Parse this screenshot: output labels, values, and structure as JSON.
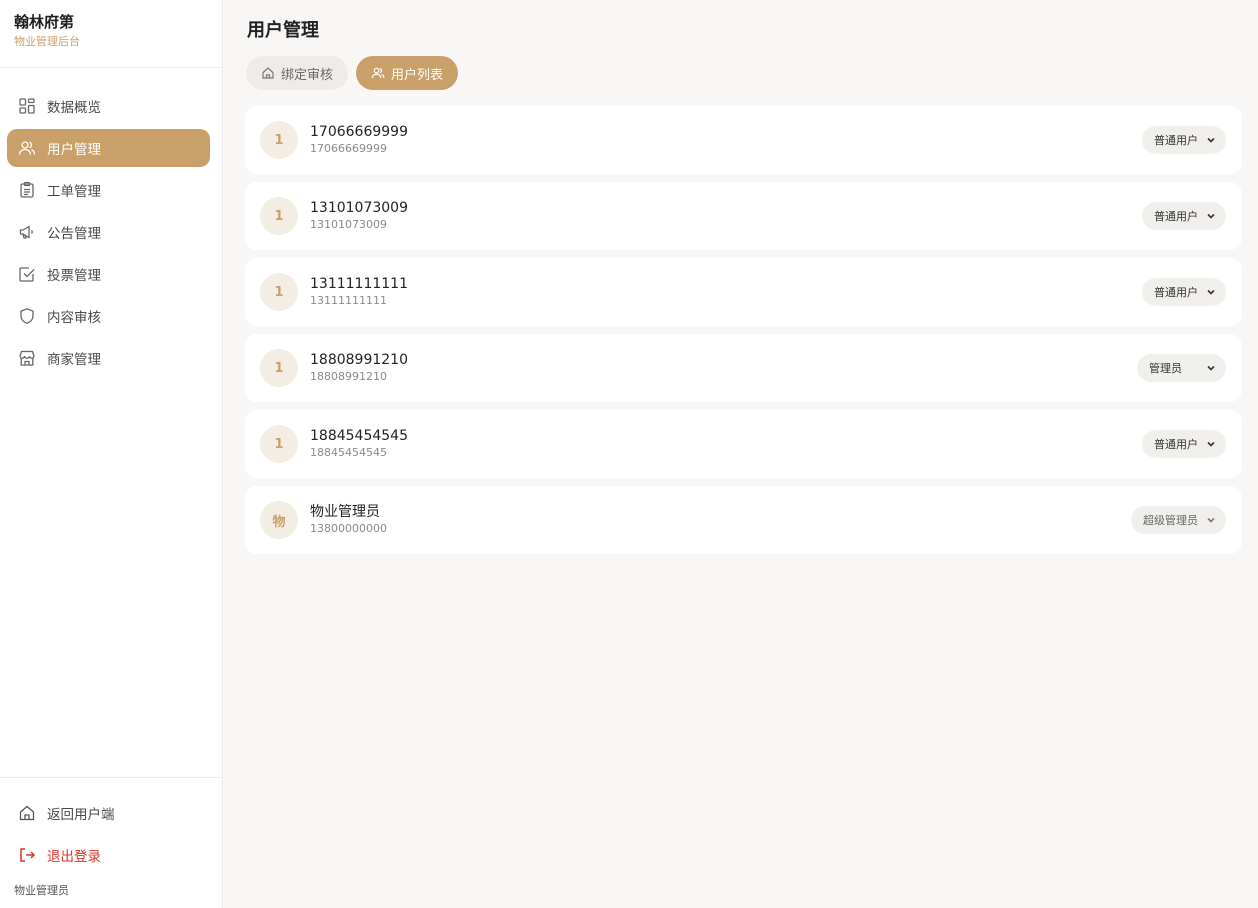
{
  "brand": {
    "title": "翰林府第",
    "subtitle": "物业管理后台"
  },
  "sidebar": {
    "items": [
      {
        "label": "数据概览",
        "icon": "grid-icon"
      },
      {
        "label": "用户管理",
        "icon": "users-icon",
        "active": true
      },
      {
        "label": "工单管理",
        "icon": "clipboard-icon"
      },
      {
        "label": "公告管理",
        "icon": "megaphone-icon"
      },
      {
        "label": "投票管理",
        "icon": "checkbox-icon"
      },
      {
        "label": "内容审核",
        "icon": "shield-icon"
      },
      {
        "label": "商家管理",
        "icon": "store-icon"
      }
    ],
    "bottom": {
      "back_label": "返回用户端",
      "logout_label": "退出登录",
      "current_user": "物业管理员"
    }
  },
  "main": {
    "title": "用户管理",
    "tabs": [
      {
        "label": "绑定审核",
        "active": false
      },
      {
        "label": "用户列表",
        "active": true
      }
    ],
    "users": [
      {
        "avatar": "1",
        "name": "17066669999",
        "phone": "17066669999",
        "role": "普通用户"
      },
      {
        "avatar": "1",
        "name": "13101073009",
        "phone": "13101073009",
        "role": "普通用户"
      },
      {
        "avatar": "1",
        "name": "13111111111",
        "phone": "13111111111",
        "role": "普通用户"
      },
      {
        "avatar": "1",
        "name": "18808991210",
        "phone": "18808991210",
        "role": "管理员"
      },
      {
        "avatar": "1",
        "name": "18845454545",
        "phone": "18845454545",
        "role": "普通用户"
      },
      {
        "avatar": "物",
        "name": "物业管理员",
        "phone": "13800000000",
        "role": "超级管理员"
      }
    ]
  },
  "colors": {
    "accent": "#c9a06a",
    "logout": "#d9372c",
    "background": "#f8f7f5"
  }
}
